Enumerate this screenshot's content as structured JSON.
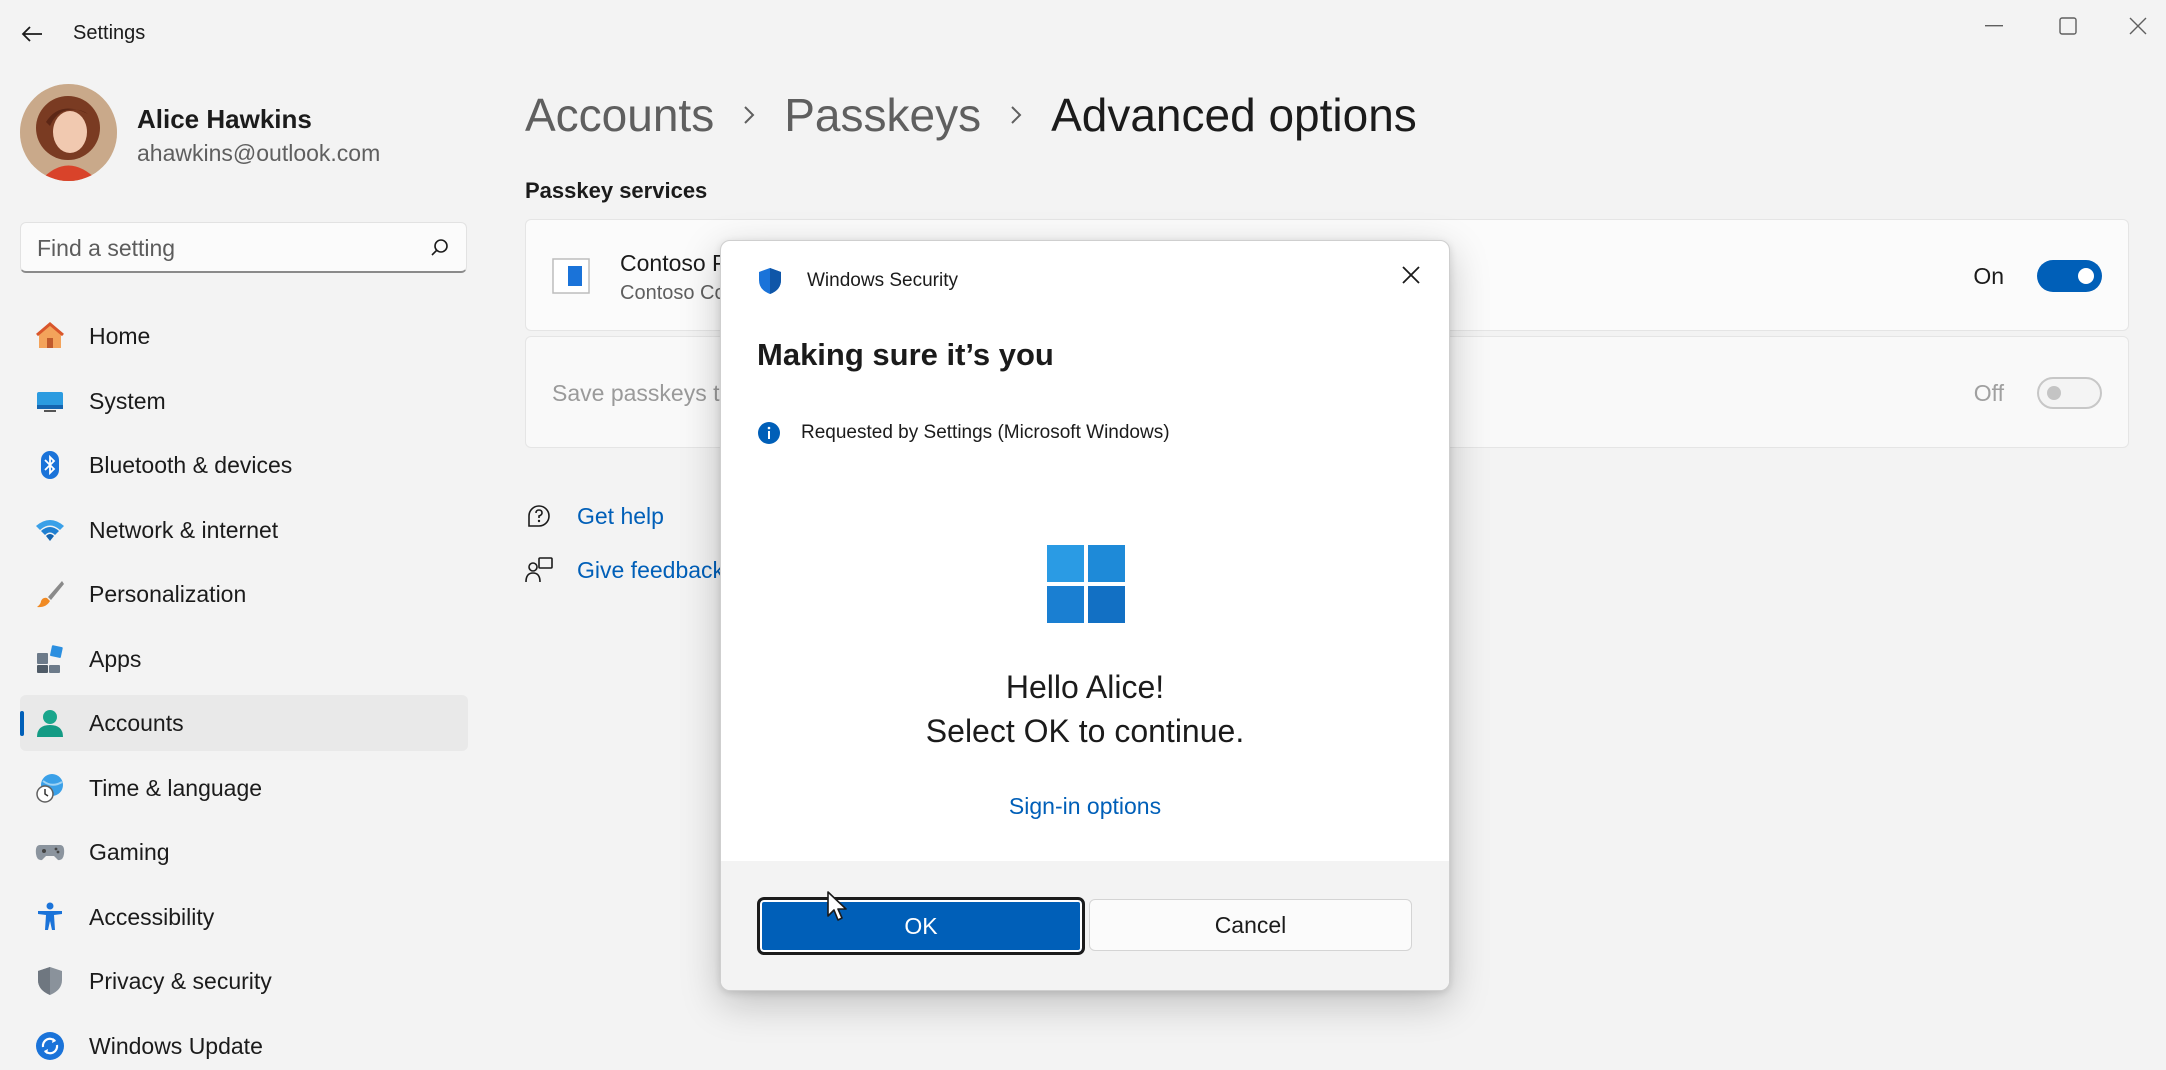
{
  "window": {
    "title": "Settings"
  },
  "profile": {
    "name": "Alice Hawkins",
    "email": "ahawkins@outlook.com"
  },
  "search": {
    "placeholder": "Find a setting"
  },
  "sidebar": {
    "items": [
      {
        "label": "Home",
        "icon": "home-icon"
      },
      {
        "label": "System",
        "icon": "system-icon"
      },
      {
        "label": "Bluetooth & devices",
        "icon": "bluetooth-icon"
      },
      {
        "label": "Network & internet",
        "icon": "wifi-icon"
      },
      {
        "label": "Personalization",
        "icon": "brush-icon"
      },
      {
        "label": "Apps",
        "icon": "apps-icon"
      },
      {
        "label": "Accounts",
        "icon": "accounts-icon",
        "active": true
      },
      {
        "label": "Time & language",
        "icon": "time-language-icon"
      },
      {
        "label": "Gaming",
        "icon": "gaming-icon"
      },
      {
        "label": "Accessibility",
        "icon": "accessibility-icon"
      },
      {
        "label": "Privacy & security",
        "icon": "shield-icon"
      },
      {
        "label": "Windows Update",
        "icon": "update-icon"
      }
    ]
  },
  "breadcrumb": [
    "Accounts",
    "Passkeys",
    "Advanced options"
  ],
  "main": {
    "section_title": "Passkey services",
    "service_card": {
      "title": "Contoso P",
      "subtitle": "Contoso Co",
      "toggle_label": "On",
      "toggle_on": true
    },
    "save_card": {
      "label": "Save passkeys to",
      "toggle_label": "Off",
      "toggle_on": false
    },
    "get_help": "Get help",
    "give_feedback": "Give feedback"
  },
  "dialog": {
    "app_title": "Windows Security",
    "heading": "Making sure it’s you",
    "requested_by": "Requested by Settings (Microsoft Windows)",
    "hello": "Hello Alice!",
    "instruction": "Select OK to continue.",
    "sign_in_options": "Sign-in options",
    "ok_label": "OK",
    "cancel_label": "Cancel"
  },
  "colors": {
    "accent": "#005fb8",
    "background": "#f3f3f3"
  }
}
